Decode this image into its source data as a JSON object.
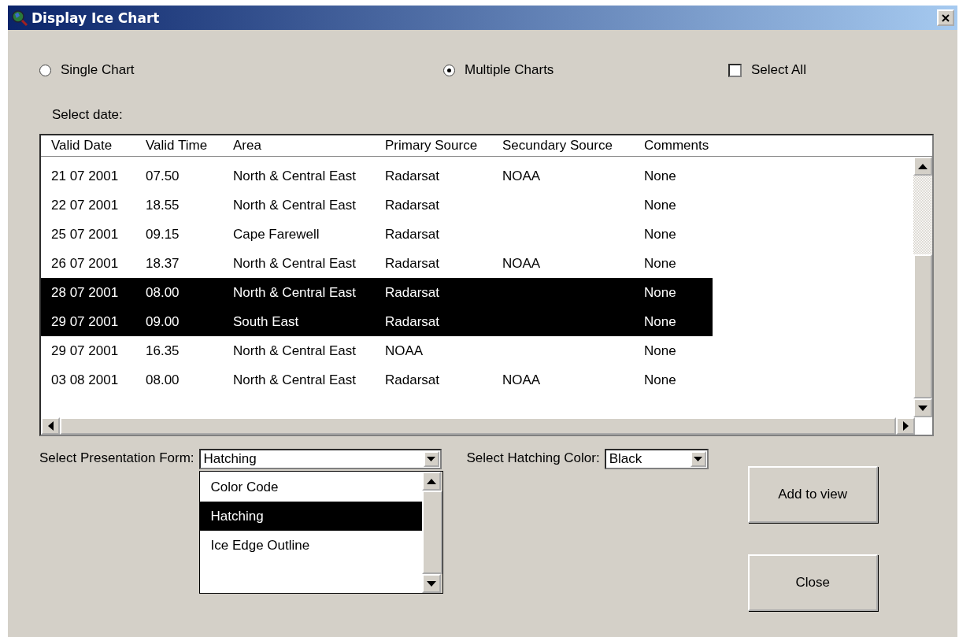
{
  "window": {
    "title": "Display Ice Chart"
  },
  "mode_options": [
    {
      "label": "Single Chart",
      "selected": false
    },
    {
      "label": "Multiple Charts",
      "selected": true
    }
  ],
  "select_all": {
    "label": "Select All",
    "checked": false
  },
  "date_label": "Select date:",
  "table": {
    "columns": [
      "Valid Date",
      "Valid Time",
      "Area",
      "Primary Source",
      "Secundary Source",
      "Comments"
    ],
    "rows": [
      {
        "cells": [
          "21 07 2001",
          "07.50",
          "North & Central East",
          "Radarsat",
          "NOAA",
          "None"
        ],
        "selected": false
      },
      {
        "cells": [
          "22 07 2001",
          "18.55",
          "North & Central East",
          "Radarsat",
          "",
          "None"
        ],
        "selected": false
      },
      {
        "cells": [
          "25 07 2001",
          "09.15",
          "Cape Farewell",
          "Radarsat",
          "",
          "None"
        ],
        "selected": false
      },
      {
        "cells": [
          "26 07 2001",
          "18.37",
          "North & Central East",
          "Radarsat",
          "NOAA",
          "None"
        ],
        "selected": false
      },
      {
        "cells": [
          "28 07 2001",
          "08.00",
          "North & Central East",
          "Radarsat",
          "",
          "None"
        ],
        "selected": true
      },
      {
        "cells": [
          "29 07 2001",
          "09.00",
          "South East",
          "Radarsat",
          "",
          "None"
        ],
        "selected": true
      },
      {
        "cells": [
          "29 07 2001",
          "16.35",
          "North & Central East",
          "NOAA",
          "",
          "None"
        ],
        "selected": false
      },
      {
        "cells": [
          "03 08 2001",
          "08.00",
          "North & Central East",
          "Radarsat",
          "NOAA",
          "None"
        ],
        "selected": false
      }
    ]
  },
  "presentation": {
    "label": "Select Presentation Form:",
    "value": "Hatching",
    "options": [
      {
        "label": "Color Code",
        "selected": false
      },
      {
        "label": "Hatching",
        "selected": true
      },
      {
        "label": "Ice Edge Outline",
        "selected": false
      }
    ]
  },
  "hatching_color": {
    "label": "Select Hatching Color:",
    "value": "Black"
  },
  "buttons": [
    "Add to view",
    "Close"
  ]
}
